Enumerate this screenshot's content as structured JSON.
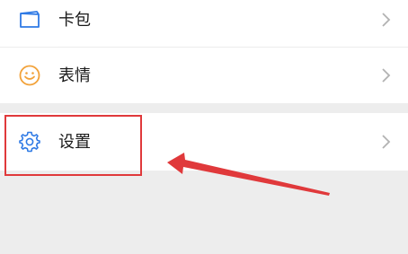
{
  "menu": {
    "items": [
      {
        "label": "卡包",
        "icon": "card-wallet-icon"
      },
      {
        "label": "表情",
        "icon": "smiley-face-icon"
      },
      {
        "label": "设置",
        "icon": "gear-icon"
      }
    ]
  },
  "annotation": {
    "highlight_color": "#e0393b",
    "target": "设置"
  },
  "colors": {
    "background": "#ededed",
    "row_background": "#ffffff",
    "icon_blue": "#2f7ae5",
    "icon_orange": "#f2a23a",
    "chevron": "#b2b2b2"
  }
}
